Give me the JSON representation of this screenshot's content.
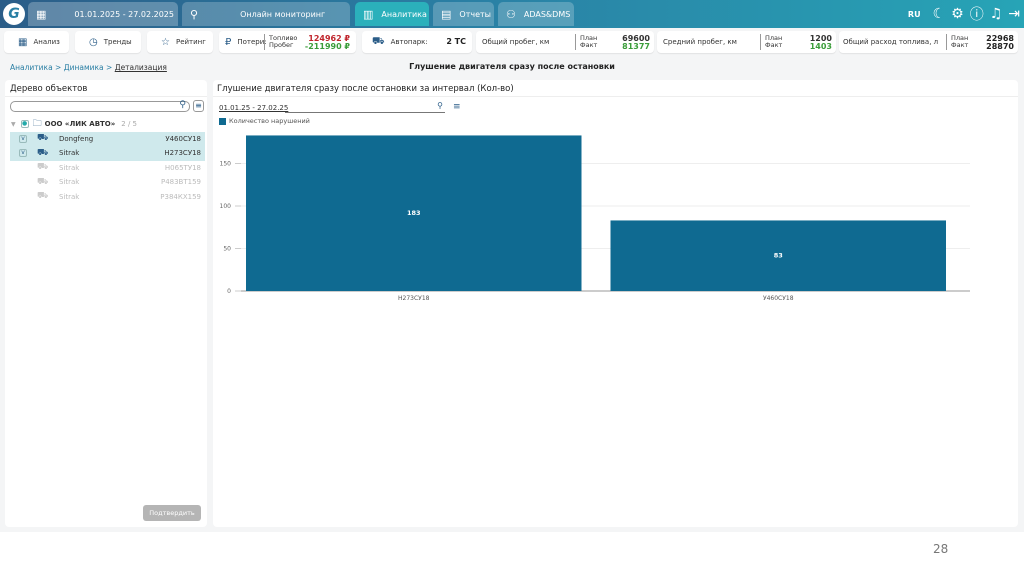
{
  "header": {
    "date_range": "01.01.2025 - 27.02.2025",
    "tabs": [
      {
        "label": "Онлайн мониторинг",
        "icon": "route-icon"
      },
      {
        "label": "Аналитика",
        "icon": "bar-chart-icon",
        "active": true
      },
      {
        "label": "Отчеты",
        "icon": "document-icon"
      },
      {
        "label": "ADAS&DMS",
        "icon": "driver-icon"
      }
    ],
    "lang": "RU"
  },
  "subnav": {
    "analysis": "Анализ",
    "trends": "Тренды",
    "rating": "Рейтинг"
  },
  "losses": {
    "label": "Потери:",
    "fuel_label": "Топливо",
    "mileage_label": "Пробег",
    "fuel_value": "124962 ₽",
    "mileage_value": "-211990 ₽"
  },
  "fleet": {
    "label": "Автопарк:",
    "value": "2 ТС"
  },
  "total_mileage": {
    "label": "Общий пробег, км",
    "plan_label": "План",
    "fact_label": "Факт",
    "plan": "69600",
    "fact": "81377"
  },
  "avg_mileage": {
    "label": "Средний пробег, км",
    "plan_label": "План",
    "fact_label": "Факт",
    "plan": "1200",
    "fact": "1403"
  },
  "fuel_total": {
    "label": "Общий расход топлива, л",
    "plan_label": "План",
    "fact_label": "Факт",
    "plan": "22968",
    "fact": "28870"
  },
  "breadcrumb": {
    "a": "Аналитика",
    "b": "Динамика",
    "c": "Детализация",
    "sep": " > "
  },
  "page_title": "Глушение двигателя сразу после остановки",
  "tree": {
    "title": "Дерево объектов",
    "org": "ООО «ЛИК АВТО»",
    "org_count": "2 / 5",
    "items": [
      {
        "name": "Dongfeng",
        "plate": "У460СУ18",
        "checked": true
      },
      {
        "name": "Sitrak",
        "plate": "Н273СУ18",
        "checked": true
      },
      {
        "name": "Sitrak",
        "plate": "Н065ТУ18",
        "checked": false
      },
      {
        "name": "Sitrak",
        "plate": "Р483ВТ159",
        "checked": false
      },
      {
        "name": "Sitrak",
        "plate": "Р384КХ159",
        "checked": false
      }
    ],
    "confirm": "Подтвердить"
  },
  "chart_panel": {
    "title": "Глушение двигателя сразу после остановки за интервал (Кол-во)",
    "date": "01.01.25 - 27.02.25"
  },
  "chart_data": {
    "type": "bar",
    "categories": [
      "Н273СУ18",
      "У460СУ18"
    ],
    "series": [
      {
        "name": "Количество нарушений",
        "values": [
          183,
          83
        ],
        "color": "#0f6a91"
      }
    ],
    "ylim": [
      0,
      190
    ],
    "yticks": [
      0,
      50,
      100,
      150
    ],
    "grid": true,
    "legend": "top-left"
  },
  "page_number": "28"
}
